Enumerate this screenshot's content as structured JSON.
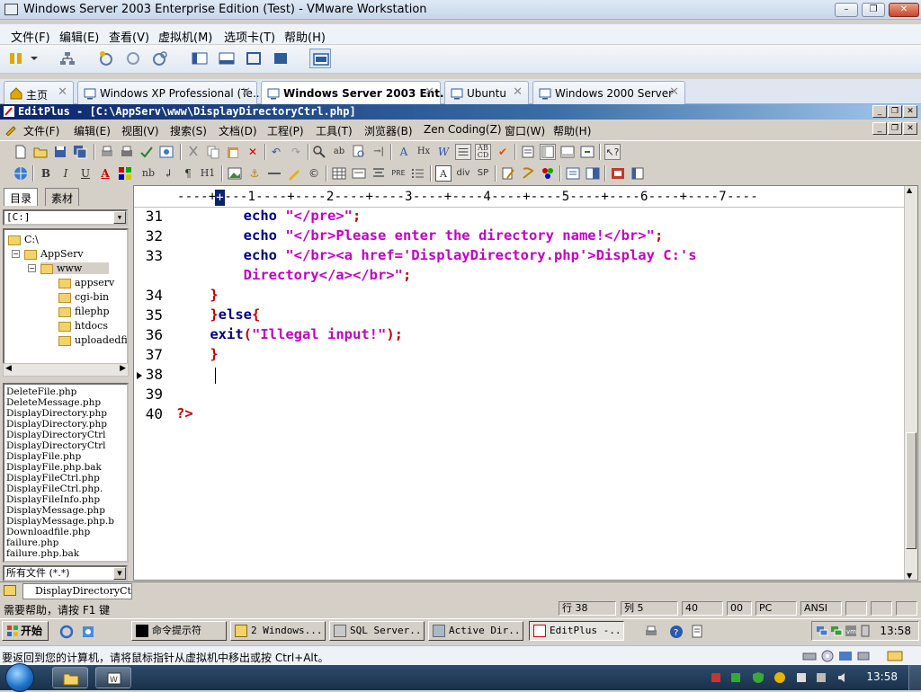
{
  "vm": {
    "title": "Windows Server 2003 Enterprise Edition (Test) - VMware Workstation",
    "menu": [
      "文件(F)",
      "编辑(E)",
      "查看(V)",
      "虚拟机(M)",
      "选项卡(T)",
      "帮助(H)"
    ],
    "tabs": [
      {
        "label": "主页"
      },
      {
        "label": "Windows XP Professional (Te..."
      },
      {
        "label": "Windows Server 2003 Ent..."
      },
      {
        "label": "Ubuntu"
      },
      {
        "label": "Windows 2000 Server"
      }
    ],
    "status_message": "要返回到您的计算机，请将鼠标指针从虚拟机中移出或按 Ctrl+Alt。"
  },
  "editplus": {
    "title": "EditPlus - [C:\\AppServ\\www\\DisplayDirectoryCtrl.php]",
    "menu": [
      "文件(F)",
      "编辑(E)",
      "视图(V)",
      "搜索(S)",
      "文档(D)",
      "工程(P)",
      "工具(T)",
      "浏览器(B)",
      "Zen Coding(Z)",
      "窗口(W)",
      "帮助(H)"
    ],
    "format_toolbar": [
      "B",
      "I",
      "U",
      "A",
      "nb",
      "↲",
      "¶",
      "H1",
      "PRE",
      "div",
      "SP"
    ],
    "left_tabs": [
      "目录",
      "素材"
    ],
    "drive": "[C:]",
    "tree": [
      "C:\\",
      "AppServ",
      "www",
      "appserv",
      "cgi-bin",
      "filephp",
      "htdocs",
      "uploadedfi"
    ],
    "files": [
      "DeleteFile.php",
      "DeleteMessage.php",
      "DisplayDirectory.php",
      "DisplayDirectory.php",
      "DisplayDirectoryCtrl",
      "DisplayDirectoryCtrl",
      "DisplayFile.php",
      "DisplayFile.php.bak",
      "DisplayFileCtrl.php",
      "DisplayFileCtrl.php.",
      "DisplayFileInfo.php",
      "DisplayMessage.php",
      "DisplayMessage.php.b",
      "Downloadfile.php",
      "failure.php",
      "failure.php.bak"
    ],
    "filter": "所有文件 (*.*)",
    "ruler": "----+----1----+----2----+----3----+----4----+----5----+----6----+----7----",
    "ruler_cursor": "+",
    "lines": [
      {
        "n": "31",
        "parts": [
          [
            "kw",
            "        echo "
          ],
          [
            "str",
            "\"</pre>\""
          ],
          [
            "op",
            ";"
          ]
        ]
      },
      {
        "n": "32",
        "parts": [
          [
            "kw",
            "        echo "
          ],
          [
            "str",
            "\"</br>Please enter the directory name!</br>\""
          ],
          [
            "op",
            ";"
          ]
        ]
      },
      {
        "n": "33",
        "parts": [
          [
            "kw",
            "        echo "
          ],
          [
            "str",
            "\"</br><a href='DisplayDirectory.php'>Display C:'s"
          ]
        ]
      },
      {
        "n": "",
        "parts": [
          [
            "str",
            "        Directory</a></br>\""
          ],
          [
            "op",
            ";"
          ]
        ]
      },
      {
        "n": "34",
        "parts": [
          [
            "op",
            "    }"
          ]
        ]
      },
      {
        "n": "35",
        "parts": [
          [
            "op",
            "    }"
          ],
          [
            "kw",
            "else"
          ],
          [
            "op",
            "{"
          ]
        ]
      },
      {
        "n": "36",
        "parts": [
          [
            "kw",
            "    exit"
          ],
          [
            "op",
            "("
          ],
          [
            "str",
            "\"Illegal input!\""
          ],
          [
            "op",
            ");"
          ]
        ]
      },
      {
        "n": "37",
        "parts": [
          [
            "op",
            "    }"
          ]
        ]
      },
      {
        "n": "38",
        "parts": []
      },
      {
        "n": "39",
        "parts": []
      },
      {
        "n": "40",
        "parts": [
          [
            "op",
            "?>"
          ]
        ]
      }
    ],
    "doc_tab": "DisplayDirectoryCtrl",
    "status": {
      "help": "需要帮助，请按 F1 键",
      "row": "行 38",
      "col": "列 5",
      "f1": "40",
      "f2": "00",
      "f3": "PC",
      "f4": "ANSI"
    }
  },
  "guest_taskbar": {
    "start": "开始",
    "buttons": [
      "命令提示符",
      "2 Windows...",
      "SQL Server...",
      "Active Dir...",
      "EditPlus -..."
    ],
    "time": "13:58"
  },
  "host_taskbar": {
    "time": "13:58"
  }
}
